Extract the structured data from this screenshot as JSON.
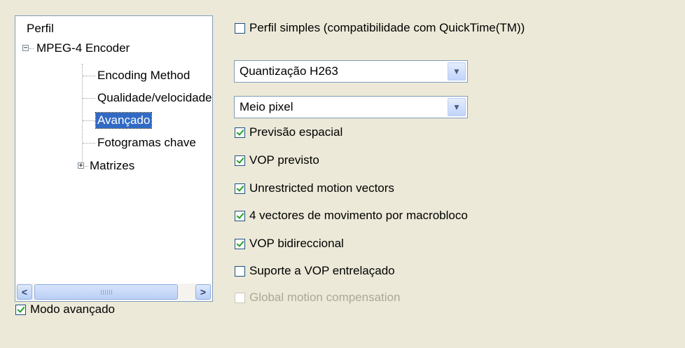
{
  "tree": {
    "root": "Perfil",
    "encoder": "MPEG-4 Encoder",
    "encoder_expander": "−",
    "items": [
      "Encoding Method",
      "Qualidade/velocidade",
      "Avançado",
      "Fotogramas chave"
    ],
    "matrices": "Matrizes",
    "matrices_expander": "+"
  },
  "scrollbar": {
    "left": "<",
    "right": ">"
  },
  "advanced_mode": {
    "label": "Modo avançado",
    "checked": true
  },
  "simple_profile": {
    "label": "Perfil simples (compatibilidade com QuickTime(TM))",
    "checked": false
  },
  "quantization": {
    "value": "Quantização H263"
  },
  "pixel": {
    "value": "Meio pixel"
  },
  "options": [
    {
      "label": "Previsão espacial",
      "checked": true,
      "disabled": false
    },
    {
      "label": "VOP previsto",
      "checked": true,
      "disabled": false
    },
    {
      "label": "Unrestricted motion vectors",
      "checked": true,
      "disabled": false
    },
    {
      "label": "4 vectores de movimento por macrobloco",
      "checked": true,
      "disabled": false
    },
    {
      "label": "VOP bidireccional",
      "checked": true,
      "disabled": false
    },
    {
      "label": "Suporte a VOP entrelaçado",
      "checked": false,
      "disabled": false
    },
    {
      "label": "Global motion compensation",
      "checked": false,
      "disabled": true
    }
  ],
  "icons": {
    "dropdown": "chevron-down-icon",
    "check": "checkmark-icon"
  },
  "colors": {
    "selection": "#316ac5",
    "check": "#21a121",
    "background": "#ece9d8"
  }
}
